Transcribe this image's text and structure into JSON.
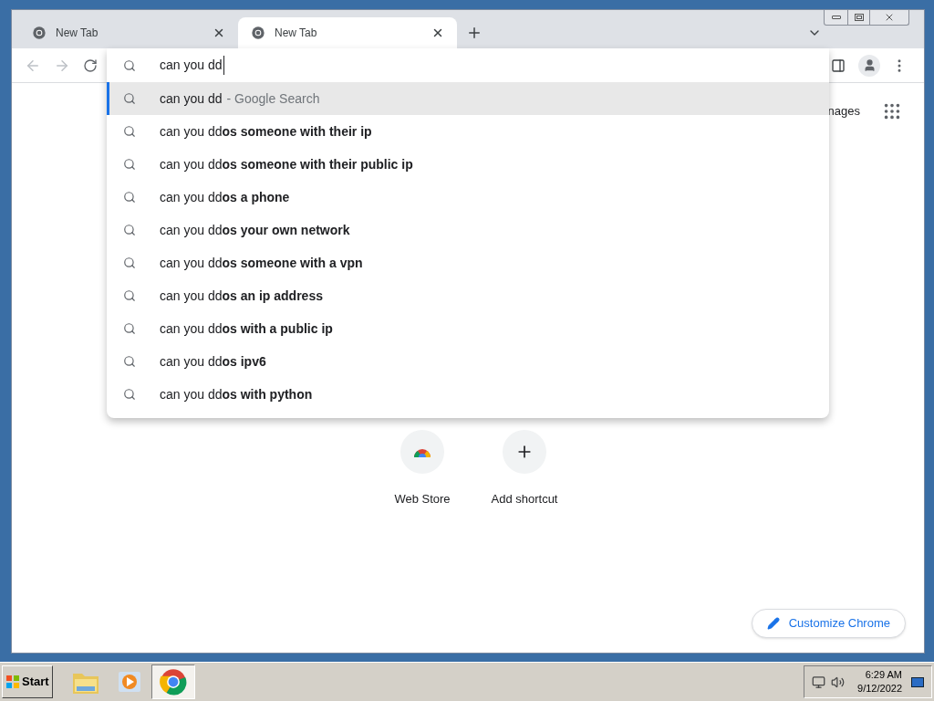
{
  "browser": {
    "tabs": [
      {
        "title": "New Tab",
        "selected": false
      },
      {
        "title": "New Tab",
        "selected": true
      }
    ],
    "omnibox": {
      "value": "can you dd"
    },
    "suggestions": [
      {
        "text": "can you dd",
        "source": "- Google Search",
        "selected": true
      },
      {
        "text": "can you dd**os someone with their ip**",
        "selected": false
      },
      {
        "text": "can you dd**os someone with their public ip**",
        "selected": false
      },
      {
        "text": "can you dd**os a phone**",
        "selected": false
      },
      {
        "text": "can you dd**os your own network**",
        "selected": false
      },
      {
        "text": "can you dd**os someone with a vpn**",
        "selected": false
      },
      {
        "text": "can you dd**os an ip address**",
        "selected": false
      },
      {
        "text": "can you dd**os with a public ip**",
        "selected": false
      },
      {
        "text": "can you dd**os ipv6**",
        "selected": false
      },
      {
        "text": "can you dd**os with python**",
        "selected": false
      }
    ],
    "page": {
      "partial_link": "nages",
      "shortcuts": [
        {
          "kind": "webstore",
          "label": "Web Store"
        },
        {
          "kind": "add",
          "label": "Add shortcut"
        }
      ],
      "customize_button": "Customize Chrome"
    }
  },
  "taskbar": {
    "start": "Start",
    "apps": [
      {
        "kind": "folder",
        "selected": false
      },
      {
        "kind": "media",
        "selected": false
      },
      {
        "kind": "chrome",
        "selected": true
      }
    ],
    "clock": {
      "time": "6:29 AM",
      "date": "9/12/2022"
    }
  }
}
